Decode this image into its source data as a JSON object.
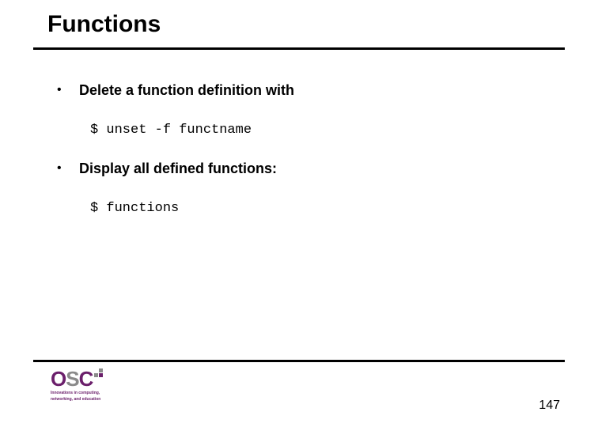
{
  "title": "Functions",
  "bullets": [
    {
      "text": "Delete a function definition with",
      "code": "$ unset -f functname"
    },
    {
      "text": "Display all defined functions:",
      "code": "$ functions"
    }
  ],
  "logo": {
    "letters": {
      "o": "O",
      "s": "S",
      "c": "C"
    },
    "tagline1": "Innovations in computing,",
    "tagline2": "networking, and education"
  },
  "page_number": "147"
}
